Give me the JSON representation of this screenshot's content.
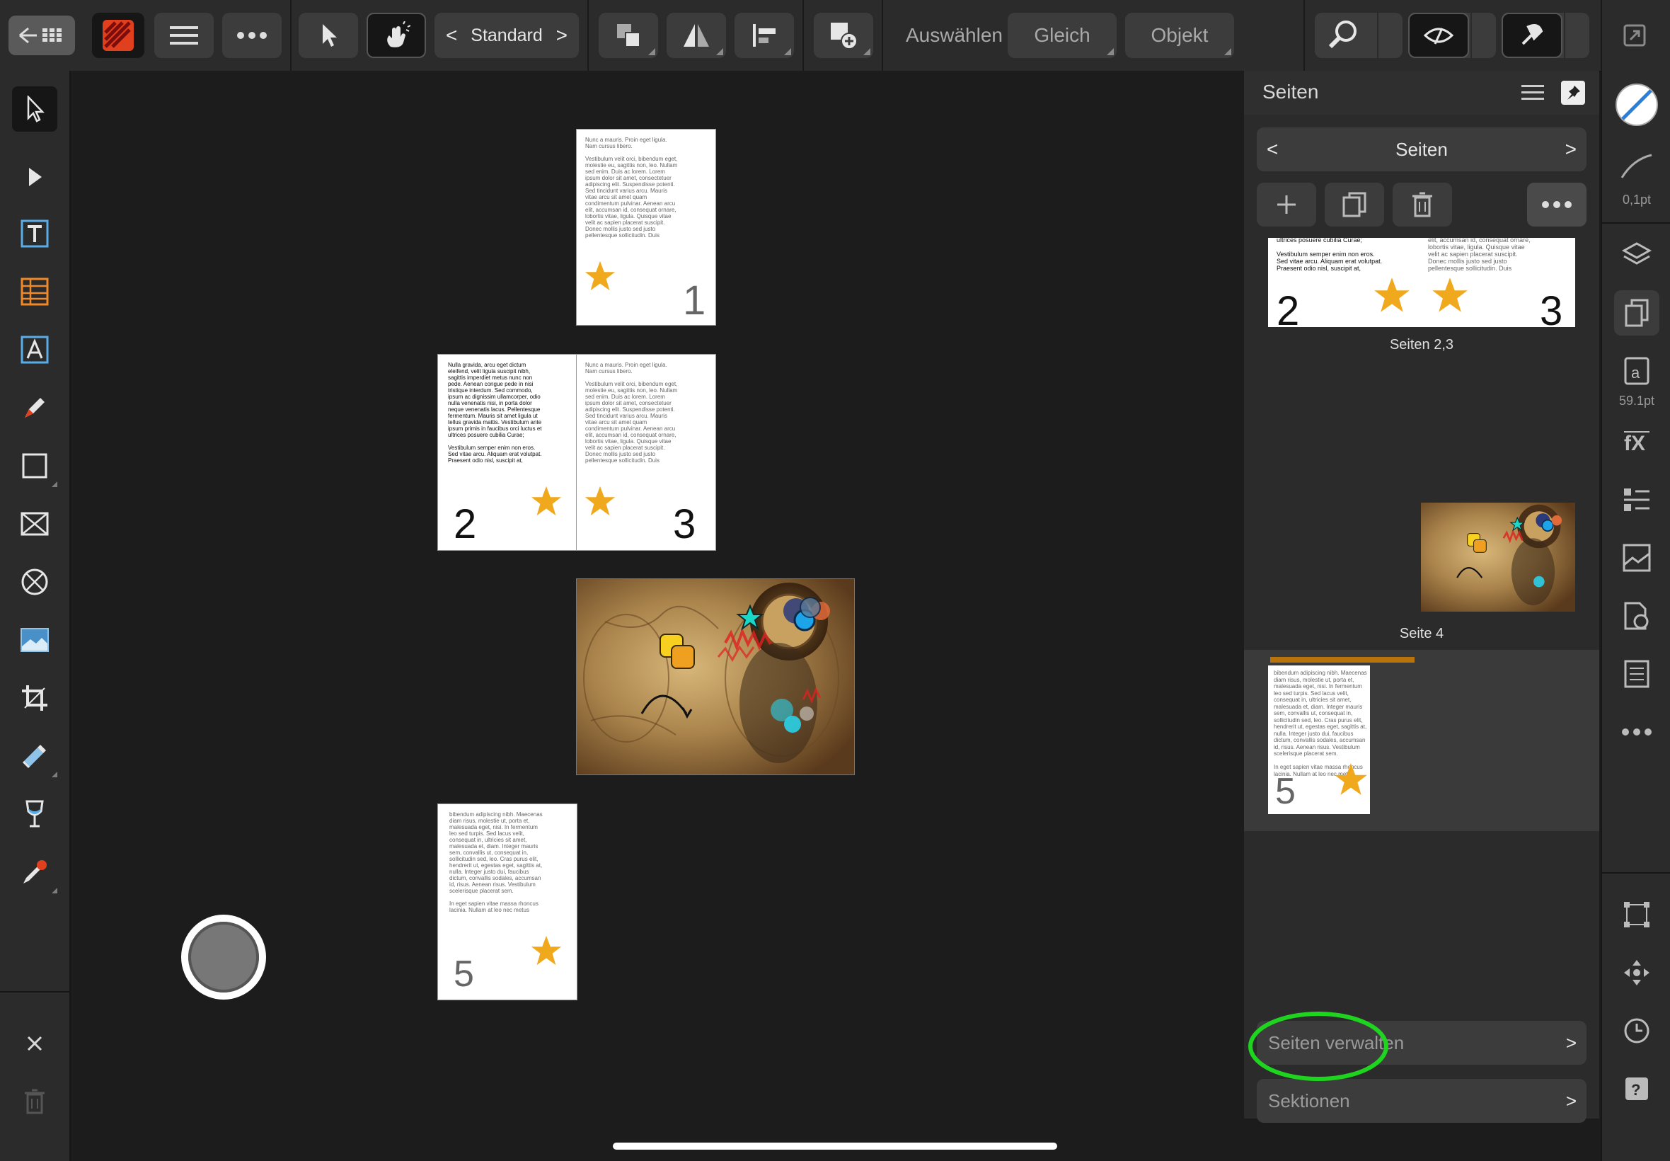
{
  "toolbar": {
    "persona_mode": "Standard",
    "select_label": "Auswählen",
    "same_label": "Gleich",
    "object_label": "Objekt",
    "icons": [
      "back-grid-icon",
      "publisher-logo",
      "menu-icon",
      "more-icon",
      "pointer-icon",
      "gesture-icon",
      "arrange-icon",
      "flip-icon",
      "align-icon",
      "insert-icon",
      "zoom-icon",
      "view-icon",
      "snapping-icon",
      "fullscreen-icon"
    ]
  },
  "canvas": {
    "pages": [
      {
        "number": "1",
        "text": "Nunc a mauris. Proin eget ligula.\nNam cursus libero.\n\nVestibulum velit orci, bibendum eget,\nmolestie eu, sagittis non, leo. Nullam\nsed enim. Duis ac lorem. Lorem\nipsum dolor sit amet, consectetuer\nadipiscing elit. Suspendisse potenti.\nSed tincidunt varius arcu. Mauris\nvitae arcu sit amet quam\ncondimentum pulvinar. Aenean arcu\nelit, accumsan id, consequat ornare,\nlobortis vitae, ligula. Quisque vitae\nvelit ac sapien placerat suscipit.\nDonec mollis justo sed justo\npellentesque sollicitudin. Duis"
      },
      {
        "number": "2",
        "text": "Nulla gravida, arcu eget dictum\neleifend, velit ligula suscipit nibh,\nsagittis imperdiet metus nunc non\npede. Aenean congue pede in nisi\ntristique interdum. Sed commodo,\nipsum ac dignissim ullamcorper, odio\nnulla venenatis nisi, in porta dolor\nneque venenatis lacus. Pellentesque\nfermentum. Mauris sit amet ligula ut\ntellus gravida mattis. Vestibulum ante\nipsum primis in faucibus orci luctus et\nultrices posuere cubilia Curae;\n\nVestibulum semper enim non eros.\nSed vitae arcu. Aliquam erat volutpat.\nPraesent odio nisl, suscipit at,"
      },
      {
        "number": "3",
        "text": "Nunc a mauris. Proin eget ligula.\nNam cursus libero.\n\nVestibulum velit orci, bibendum eget,\nmolestie eu, sagittis non, leo. Nullam\nsed enim. Duis ac lorem. Lorem\nipsum dolor sit amet, consectetuer\nadipiscing elit. Suspendisse potenti.\nSed tincidunt varius arcu. Mauris\nvitae arcu sit amet quam\ncondimentum pulvinar. Aenean arcu\nelit, accumsan id, consequat ornare,\nlobortis vitae, ligula. Quisque vitae\nvelit ac sapien placerat suscipit.\nDonec mollis justo sed justo\npellentesque sollicitudin. Duis"
      },
      {
        "number": "5",
        "text": "bibendum adipiscing nibh. Maecenas\ndiam risus, molestie ut, porta et,\nmalesuada eget, nisi. In fermentum\nleo sed turpis. Sed lacus velit,\nconsequat in, ultricies sit amet,\nmalesuada et, diam. Integer mauris\nsem, convallis ut, consequat in,\nsollicitudin sed, leo. Cras purus elit,\nhendrerit ut, egestas eget, sagittis at,\nnulla. Integer justo dui, faucibus\ndictum, convallis sodales, accumsan\nid, risus. Aenean risus. Vestibulum\nscelerisque placerat sem.\n\nIn eget sapien vitae massa rhoncus\nlacinia. Nullam at leo nec metus"
      }
    ]
  },
  "panel": {
    "title": "Seiten",
    "nav_title": "Seiten",
    "spread_top_text_left": "ipsum primis in faucibus orci luctus et\nultrices posuere cubilia Curae;\n\nVestibulum semper enim non eros.\nSed vitae arcu. Aliquam erat volutpat.\nPraesent odio nisl, suscipit at,",
    "spread_top_text_right": "condimentum pulvinar. Aenean arcu\nelit, accumsan id, consequat ornare,\nlobortis vitae, ligula. Quisque vitae\nvelit ac sapien placerat suscipit.\nDonec mollis justo sed justo\npellentesque sollicitudin. Duis",
    "spread_left_num": "2",
    "spread_right_num": "3",
    "spread_caption": "Seiten 2,3",
    "page4_caption": "Seite 4",
    "page5_text": "bibendum adipiscing nibh. Maecenas\ndiam risus, molestie ut, porta et,\nmalesuada eget, nisi. In fermentum\nleo sed turpis. Sed lacus velit,\nconsequat in, ultricies sit amet,\nmalesuada et, diam. Integer mauris\nsem, convallis ut, consequat in,\nsollicitudin sed, leo. Cras purus elit,\nhendrerit ut, egestas eget, sagittis at,\nnulla. Integer justo dui, faucibus\ndictum, convallis sodales, accumsan\nid, risus. Aenean risus. Vestibulum\nscelerisque placerat sem.\n\nIn eget sapien vitae massa rhoncus\nlacinia. Nullam at leo nec metus",
    "page5_num": "5",
    "manage_pages": "Seiten verwalten",
    "sections": "Sektionen"
  },
  "right_strip": {
    "stroke_width": "0,1pt",
    "font_size": "59.1pt"
  },
  "colors": {
    "star": "#f0a81c",
    "highlight_ring": "#1fd41f",
    "selected_page_bar": "#b8730b"
  }
}
